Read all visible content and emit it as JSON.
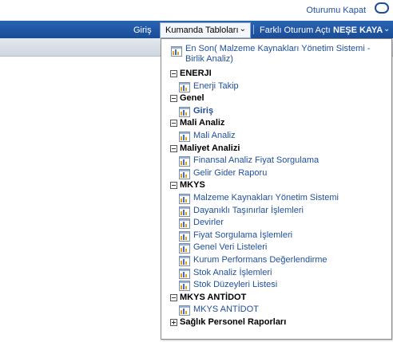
{
  "header": {
    "signout_label": "Oturumu Kapat"
  },
  "nav": {
    "home_label": "Giriş",
    "dashboards_label": "Kumanda Tabloları",
    "sign_in_other_label": "Farklı Oturum Açtı",
    "user_label": "NEŞE KAYA"
  },
  "menu": {
    "recent_label": "En Son( Malzeme Kaynakları Yönetim Sistemi - Birlik Analiz)",
    "groups": [
      {
        "label": "ENERJI",
        "items": [
          "Enerji Takip"
        ]
      },
      {
        "label": "Genel",
        "items": [
          "Giriş"
        ]
      },
      {
        "label": "Mali Analiz",
        "items": [
          "Mali Analiz"
        ]
      },
      {
        "label": "Maliyet Analizi",
        "items": [
          "Finansal Analiz Fiyat Sorgulama",
          "Gelir Gider Raporu"
        ]
      },
      {
        "label": "MKYS",
        "items": [
          "Malzeme Kaynakları Yönetim Sistemi",
          "Dayanıklı Taşınırlar İşlemleri",
          "Devirler",
          "Fiyat Sorgulama İşlemleri",
          "Genel Veri Listeleri",
          "Kurum Performans Değerlendirme",
          "Stok Analiz İşlemleri",
          "Stok Düzeyleri Listesi"
        ]
      },
      {
        "label": "MKYS ANTİDOT",
        "items": [
          "MKYS ANTİDOT"
        ]
      },
      {
        "label": "Sağlık Personel Raporları",
        "items": []
      }
    ]
  },
  "colors": {
    "nav_bar": "#1f559f",
    "link_text": "#1f4f9e"
  }
}
